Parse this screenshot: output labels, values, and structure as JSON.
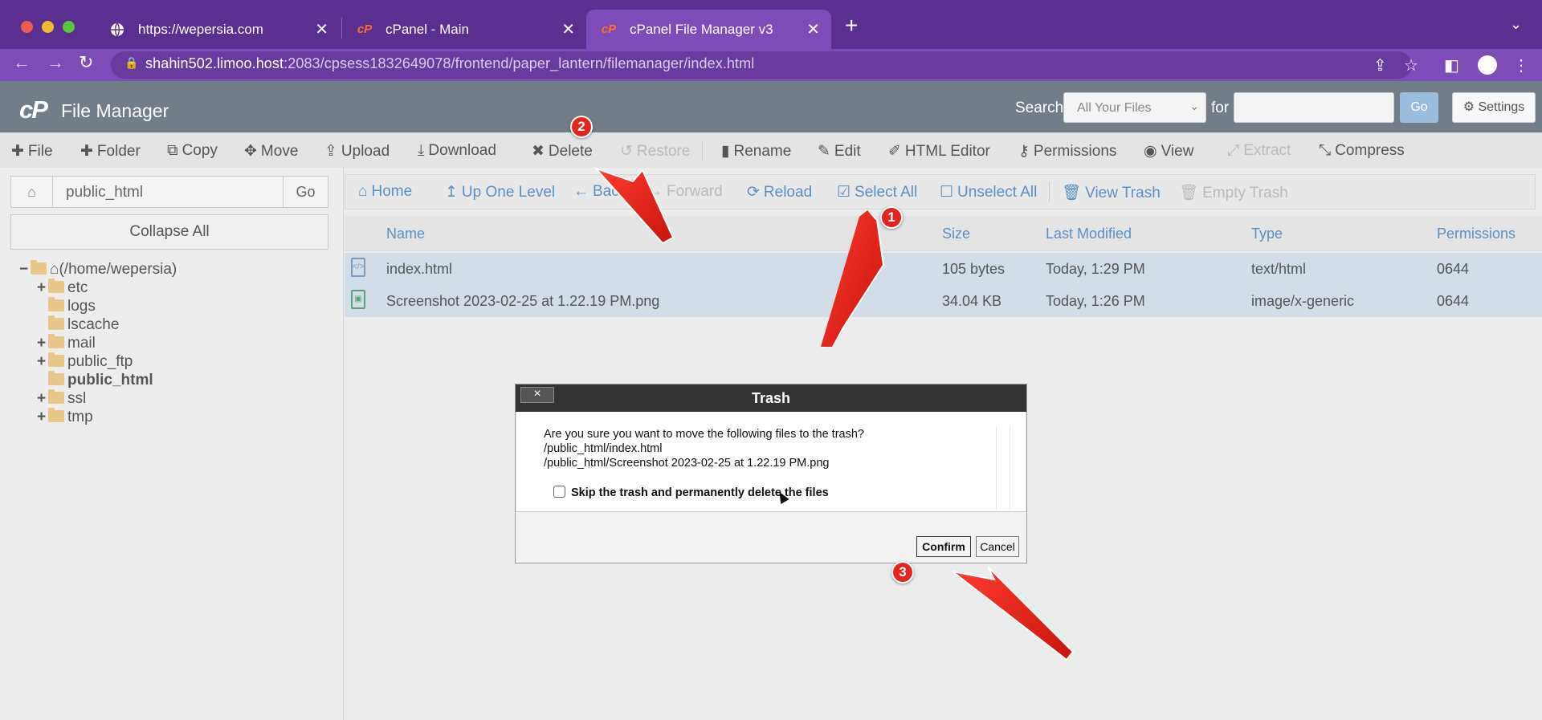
{
  "browser": {
    "tabs": [
      {
        "title": "https://wepersia.com",
        "active": false
      },
      {
        "title": "cPanel - Main",
        "active": false
      },
      {
        "title": "cPanel File Manager v3",
        "active": true
      }
    ],
    "url_host": "shahin502.limoo.host",
    "url_path": ":2083/cpsess1832649078/frontend/paper_lantern/filemanager/index.html"
  },
  "header": {
    "logo": "cP",
    "title": "File Manager",
    "search_label": "Search",
    "search_scope": "All Your Files",
    "for_label": "for",
    "search_value": "",
    "go_label": "Go",
    "settings_label": "Settings"
  },
  "toolbar": {
    "file": "File",
    "folder": "Folder",
    "copy": "Copy",
    "move": "Move",
    "upload": "Upload",
    "download": "Download",
    "delete": "Delete",
    "restore": "Restore",
    "rename": "Rename",
    "edit": "Edit",
    "html_editor": "HTML Editor",
    "permissions": "Permissions",
    "view": "View",
    "extract": "Extract",
    "compress": "Compress"
  },
  "sidebar": {
    "path": "public_html",
    "go": "Go",
    "collapse_all": "Collapse All",
    "root": "(/home/wepersia)",
    "folders": [
      {
        "name": "etc",
        "expandable": true,
        "bold": false
      },
      {
        "name": "logs",
        "expandable": false,
        "bold": false
      },
      {
        "name": "lscache",
        "expandable": false,
        "bold": false
      },
      {
        "name": "mail",
        "expandable": true,
        "bold": false
      },
      {
        "name": "public_ftp",
        "expandable": true,
        "bold": false
      },
      {
        "name": "public_html",
        "expandable": false,
        "bold": true
      },
      {
        "name": "ssl",
        "expandable": true,
        "bold": false
      },
      {
        "name": "tmp",
        "expandable": true,
        "bold": false
      }
    ]
  },
  "subtoolbar": {
    "home": "Home",
    "up": "Up One Level",
    "back": "Back",
    "forward": "Forward",
    "reload": "Reload",
    "select_all": "Select All",
    "unselect_all": "Unselect All",
    "view_trash": "View Trash",
    "empty_trash": "Empty Trash"
  },
  "table": {
    "columns": [
      "Name",
      "Size",
      "Last Modified",
      "Type",
      "Permissions"
    ],
    "rows": [
      {
        "name": "index.html",
        "size": "105 bytes",
        "modified": "Today, 1:29 PM",
        "type": "text/html",
        "perms": "0644"
      },
      {
        "name": "Screenshot 2023-02-25 at 1.22.19 PM.png",
        "size": "34.04 KB",
        "modified": "Today, 1:26 PM",
        "type": "image/x-generic",
        "perms": "0644"
      }
    ]
  },
  "dialog": {
    "title": "Trash",
    "close": "×",
    "question": "Are you sure you want to move the following files to the trash?",
    "files": [
      "/public_html/index.html",
      "/public_html/Screenshot 2023-02-25 at 1.22.19 PM.png"
    ],
    "skip_label": "Skip the trash and permanently delete the files",
    "confirm": "Confirm",
    "cancel": "Cancel"
  },
  "annotations": {
    "badge1": "1",
    "badge2": "2",
    "badge3": "3",
    "arrow_color": "#e2261f"
  }
}
